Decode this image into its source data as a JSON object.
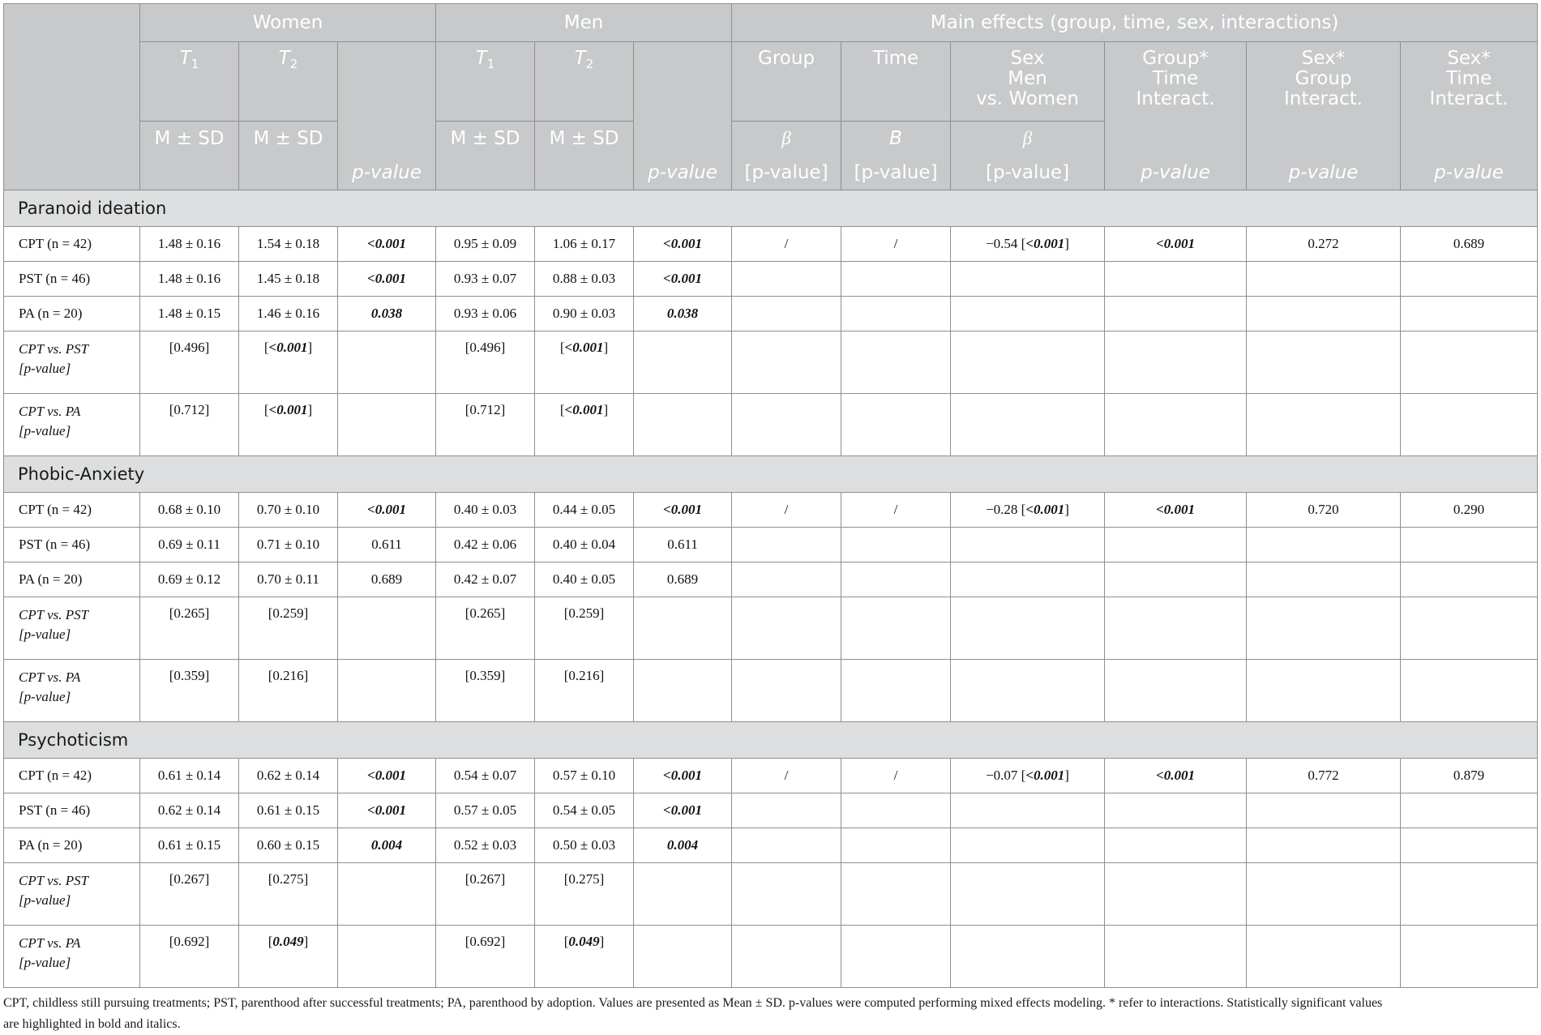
{
  "header": {
    "women": "Women",
    "men": "Men",
    "main_effects": "Main effects (group, time, sex, interactions)",
    "t1_letter": "T",
    "t1_sub": "1",
    "t2_letter": "T",
    "t2_sub": "2",
    "group": "Group",
    "time": "Time",
    "sex_line1": "Sex",
    "sex_line2": "Men",
    "sex_line3": "vs. Women",
    "gt_line1": "Group*",
    "gt_line2": "Time",
    "gt_line3": "Interact.",
    "sg_line1": "Sex*",
    "sg_line2": "Group",
    "sg_line3": "Interact.",
    "st_line1": "Sex*",
    "st_line2": "Time",
    "st_line3": "Interact.",
    "msd": "M ± SD",
    "beta": "β",
    "b": "B",
    "pvalue": "p-value",
    "pvalue_br": "[p-value]"
  },
  "sections": {
    "paranoid": {
      "title": "Paranoid ideation",
      "cpt": {
        "label": "CPT (n = 42)",
        "w_t1": "1.48 ± 0.16",
        "w_t2": "1.54 ± 0.18",
        "w_p": "<0.001",
        "m_t1": "0.95 ± 0.09",
        "m_t2": "1.06 ± 0.17",
        "m_p": "<0.001",
        "group": "/",
        "time": "/",
        "sex_val": "−0.54 [",
        "sex_p": "<0.001",
        "sex_close": "]",
        "gt": "<0.001",
        "sg": "0.272",
        "st": "0.689"
      },
      "pst": {
        "label": "PST (n = 46)",
        "w_t1": "1.48 ± 0.16",
        "w_t2": "1.45 ± 0.18",
        "w_p": "<0.001",
        "m_t1": "0.93 ± 0.07",
        "m_t2": "0.88 ± 0.03",
        "m_p": "<0.001"
      },
      "pa": {
        "label": "PA (n = 20)",
        "w_t1": "1.48 ± 0.15",
        "w_t2": "1.46 ± 0.16",
        "w_p": "0.038",
        "m_t1": "0.93 ± 0.06",
        "m_t2": "0.90 ± 0.03",
        "m_p": "0.038"
      },
      "cvp": {
        "label1": "CPT vs. PST",
        "label2": "[p-value]",
        "w_t1": "[0.496]",
        "w_t2": "<0.001",
        "m_t1": "[0.496]",
        "m_t2": "<0.001"
      },
      "cva": {
        "label1": "CPT vs. PA",
        "label2": "[p-value]",
        "w_t1": "[0.712]",
        "w_t2": "<0.001",
        "m_t1": "[0.712]",
        "m_t2": "<0.001"
      }
    },
    "phobic": {
      "title": "Phobic-Anxiety",
      "cpt": {
        "label": "CPT (n = 42)",
        "w_t1": "0.68 ± 0.10",
        "w_t2": "0.70 ± 0.10",
        "w_p": "<0.001",
        "m_t1": "0.40 ± 0.03",
        "m_t2": "0.44 ± 0.05",
        "m_p": "<0.001",
        "group": "/",
        "time": "/",
        "sex_val": "−0.28 [",
        "sex_p": "<0.001",
        "sex_close": "]",
        "gt": "<0.001",
        "sg": "0.720",
        "st": "0.290"
      },
      "pst": {
        "label": "PST (n = 46)",
        "w_t1": "0.69 ± 0.11",
        "w_t2": "0.71 ± 0.10",
        "w_p": "0.611",
        "m_t1": "0.42 ± 0.06",
        "m_t2": "0.40 ± 0.04",
        "m_p": "0.611"
      },
      "pa": {
        "label": "PA (n = 20)",
        "w_t1": "0.69 ± 0.12",
        "w_t2": "0.70 ± 0.11",
        "w_p": "0.689",
        "m_t1": "0.42 ± 0.07",
        "m_t2": "0.40 ± 0.05",
        "m_p": "0.689"
      },
      "cvp": {
        "label1": "CPT vs. PST",
        "label2": "[p-value]",
        "w_t1": "[0.265]",
        "w_t2": "[0.259]",
        "m_t1": "[0.265]",
        "m_t2": "[0.259]"
      },
      "cva": {
        "label1": "CPT vs. PA",
        "label2": "[p-value]",
        "w_t1": "[0.359]",
        "w_t2": "[0.216]",
        "m_t1": "[0.359]",
        "m_t2": "[0.216]"
      }
    },
    "psychoticism": {
      "title": "Psychoticism",
      "cpt": {
        "label": "CPT (n = 42)",
        "w_t1": "0.61 ± 0.14",
        "w_t2": "0.62 ± 0.14",
        "w_p": "<0.001",
        "m_t1": "0.54 ± 0.07",
        "m_t2": "0.57 ± 0.10",
        "m_p": "<0.001",
        "group": "/",
        "time": "/",
        "sex_val": "−0.07 [",
        "sex_p": "<0.001",
        "sex_close": "]",
        "gt": "<0.001",
        "sg": "0.772",
        "st": "0.879"
      },
      "pst": {
        "label": "PST (n = 46)",
        "w_t1": "0.62 ± 0.14",
        "w_t2": "0.61 ± 0.15",
        "w_p": "<0.001",
        "m_t1": "0.57 ± 0.05",
        "m_t2": "0.54 ± 0.05",
        "m_p": "<0.001"
      },
      "pa": {
        "label": "PA (n = 20)",
        "w_t1": "0.61 ± 0.15",
        "w_t2": "0.60 ± 0.15",
        "w_p": "0.004",
        "m_t1": "0.52 ± 0.03",
        "m_t2": "0.50 ± 0.03",
        "m_p": "0.004"
      },
      "cvp": {
        "label1": "CPT vs. PST",
        "label2": "[p-value]",
        "w_t1": "[0.267]",
        "w_t2": "[0.275]",
        "m_t1": "[0.267]",
        "m_t2": "[0.275]"
      },
      "cva": {
        "label1": "CPT vs. PA",
        "label2": "[p-value]",
        "w_t1": "[0.692]",
        "w_t2": "0.049",
        "m_t1": "[0.692]",
        "m_t2": "0.049"
      }
    }
  },
  "footnote": {
    "line1": "CPT, childless still pursuing treatments; PST, parenthood after successful treatments; PA, parenthood by adoption. Values are presented as Mean ± SD. p-values were computed performing mixed effects modeling. * refer to interactions. Statistically significant values",
    "line2": "are highlighted in bold and italics."
  },
  "colors": {
    "header_bg": "#c7c9cb",
    "section_bg": "#dcdedf",
    "header_text": "#ffffff",
    "border": "#8f8f8f"
  }
}
